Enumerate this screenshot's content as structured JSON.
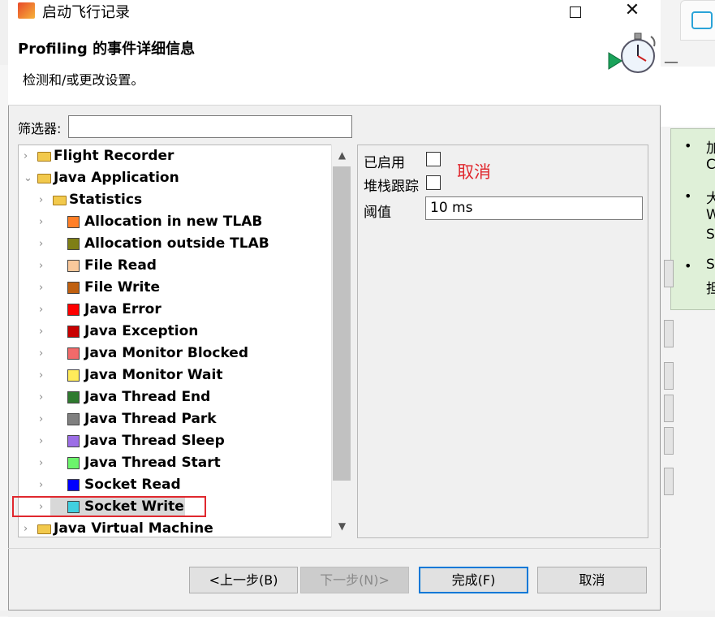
{
  "window": {
    "title": "启动飞行记录"
  },
  "header": {
    "title": "Profiling 的事件详细信息",
    "description": "检测和/或更改设置。"
  },
  "filter": {
    "label": "筛选器:",
    "value": ""
  },
  "tree": {
    "items": [
      {
        "label": "Flight Recorder",
        "kind": "folder",
        "color": "",
        "level": 0
      },
      {
        "label": "Java Application",
        "kind": "folder",
        "color": "",
        "level": 0
      },
      {
        "label": "Statistics",
        "kind": "folder",
        "color": "",
        "level": 1
      },
      {
        "label": "Allocation in new TLAB",
        "kind": "event",
        "color": "#ff7f27",
        "level": 1
      },
      {
        "label": "Allocation outside TLAB",
        "kind": "event",
        "color": "#7f7f16",
        "level": 1
      },
      {
        "label": "File Read",
        "kind": "event",
        "color": "#f9c89b",
        "level": 1
      },
      {
        "label": "File Write",
        "kind": "event",
        "color": "#c06010",
        "level": 1
      },
      {
        "label": "Java Error",
        "kind": "event",
        "color": "#ff0000",
        "level": 1
      },
      {
        "label": "Java Exception",
        "kind": "event",
        "color": "#c80000",
        "level": 1
      },
      {
        "label": "Java Monitor Blocked",
        "kind": "event",
        "color": "#f26a6a",
        "level": 1
      },
      {
        "label": "Java Monitor Wait",
        "kind": "event",
        "color": "#ffeb5a",
        "level": 1
      },
      {
        "label": "Java Thread End",
        "kind": "event",
        "color": "#2f7a2f",
        "level": 1
      },
      {
        "label": "Java Thread Park",
        "kind": "event",
        "color": "#808080",
        "level": 1
      },
      {
        "label": "Java Thread Sleep",
        "kind": "event",
        "color": "#9c6ee6",
        "level": 1
      },
      {
        "label": "Java Thread Start",
        "kind": "event",
        "color": "#6cf56c",
        "level": 1
      },
      {
        "label": "Socket Read",
        "kind": "event",
        "color": "#0000ff",
        "level": 1
      },
      {
        "label": "Socket Write",
        "kind": "event",
        "color": "#40d0e0",
        "level": 1
      },
      {
        "label": "Java Virtual Machine",
        "kind": "folder",
        "color": "",
        "level": 0
      }
    ],
    "selected": "Socket Write"
  },
  "settings": {
    "enabled_label": "已启用",
    "enabled": false,
    "stacktrace_label": "堆栈跟踪",
    "stacktrace": false,
    "annotation": "取消",
    "threshold_label": "阈值",
    "threshold_value": "10 ms"
  },
  "buttons": {
    "back": "<上一步(B)",
    "next": "下一步(N)>",
    "finish": "完成(F)",
    "cancel": "取消"
  },
  "background": {
    "tip_fragments": [
      "加",
      "C",
      "大",
      "W",
      "S",
      "S",
      "担"
    ]
  },
  "colors": {
    "annotation_red": "#e0282e",
    "focus_blue": "#0078d7"
  }
}
